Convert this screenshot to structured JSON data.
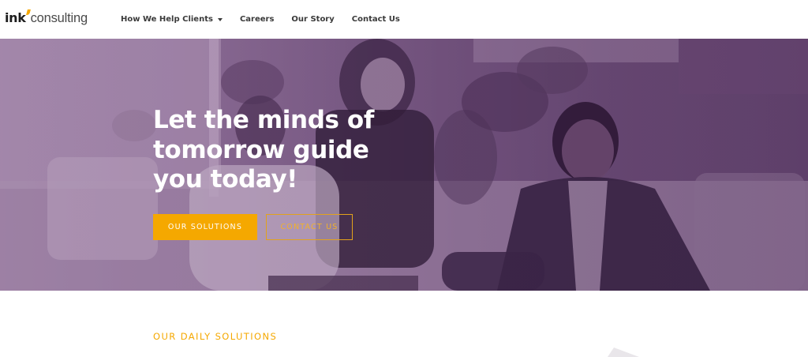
{
  "header": {
    "logo": {
      "ink": "ink",
      "consulting": "consulting"
    },
    "nav": [
      {
        "label": "How We Help Clients",
        "has_dropdown": true
      },
      {
        "label": "Careers"
      },
      {
        "label": "Our Story"
      },
      {
        "label": "Contact Us"
      }
    ]
  },
  "hero": {
    "title_lines": [
      "Let the minds of",
      "tomorrow guide",
      "you today!"
    ],
    "primary_button": "OUR SOLUTIONS",
    "secondary_button": "CONTACT US"
  },
  "section": {
    "label": "OUR DAILY SOLUTIONS"
  },
  "colors": {
    "accent": "#f5a800",
    "hero_tint": "#6d4d78",
    "nav_text": "#3a3a3a"
  }
}
